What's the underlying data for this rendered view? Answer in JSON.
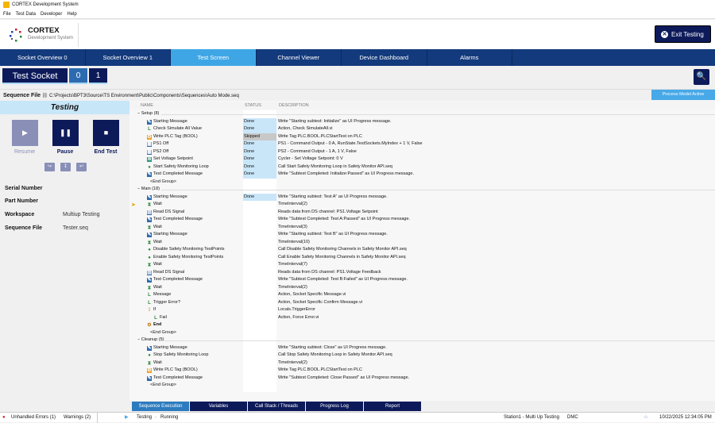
{
  "window": {
    "title": "CORTEX Development System"
  },
  "menu": [
    "File",
    "Test Data",
    "Developer",
    "Help"
  ],
  "logo": {
    "title": "CORTEX",
    "subtitle": "Development System"
  },
  "exit_button": "Exit Testing",
  "nav_tabs": [
    {
      "label": "Socket Overview 0"
    },
    {
      "label": "Socket Overview 1"
    },
    {
      "label": "Test Screen",
      "active": true
    },
    {
      "label": "Channel Viewer"
    },
    {
      "label": "Device Dashboard"
    },
    {
      "label": "Alarms"
    }
  ],
  "socket": {
    "label": "Test Socket",
    "buttons": [
      "0",
      "1"
    ],
    "selected": "0"
  },
  "sequence_file": {
    "label": "Sequence File",
    "path": "C:\\Projects\\BPT3\\Source\\TS Environment\\Public\\Components\\Sequences\\Auto Mode.seq",
    "badge": "Process Model Active"
  },
  "left": {
    "state": "Testing",
    "resume": "Resume",
    "pause": "Pause",
    "end_test": "End Test",
    "info": [
      {
        "key": "Serial Number",
        "value": ""
      },
      {
        "key": "Part Number",
        "value": ""
      },
      {
        "key": "Workspace",
        "value": "Multiup Testing"
      },
      {
        "key": "Sequence File",
        "value": "Tester.seq"
      }
    ]
  },
  "table": {
    "columns": [
      "NAME",
      "STATUS",
      "DESCRIPTION"
    ],
    "rows": [
      {
        "group": "Setup (8)"
      },
      {
        "icon": "message",
        "name": "Starting Message",
        "status": "Done",
        "desc": "Write \"Starting subtest: Initialize\" as UI Progress message."
      },
      {
        "icon": "action",
        "name": "Check Simulate All Value",
        "status": "Done",
        "desc": "Action,  Check SimulateAll.vi"
      },
      {
        "icon": "plc",
        "name": "Write PLC Tag (BOOL)",
        "status": "Skipped",
        "desc": "Write Tag PLC.BOOL.PLCStartTest on PLC"
      },
      {
        "icon": "ps",
        "name": "PS1 Off",
        "status": "Done",
        "desc": "PS1 - Command Output - 0 A, RunState.TestSockets.MyIndex + 1 V, False"
      },
      {
        "icon": "ps",
        "name": "PS2 Off",
        "status": "Done",
        "desc": "PS2 - Command Output - 1 A, 1 V, False"
      },
      {
        "icon": "cycler",
        "name": "Set Voltage Setpoint",
        "status": "Done",
        "desc": "Cycler - Set Voltage Setpoint: 0 V"
      },
      {
        "icon": "safety",
        "name": "Start Safety Monitoring Loop",
        "status": "Done",
        "desc": "Call Start Safety Monitoring Loop in Safety Monitor API.seq"
      },
      {
        "icon": "message",
        "name": "Test Completed Message",
        "status": "Done",
        "desc": "Write \"Subtest Completed: Initialize:Passed\" as UI Progress message."
      },
      {
        "end": "<End Group>"
      },
      {
        "group": "Main (18)"
      },
      {
        "icon": "message",
        "name": "Starting Message",
        "status": "Done",
        "desc": "Write \"Starting subtest: Test A\" as UI Progress message."
      },
      {
        "icon": "wait",
        "name": "Wait",
        "desc": "TimeInterval(2)",
        "current": true
      },
      {
        "icon": "read",
        "name": "Read DS Signal",
        "desc": "Reads data from DS channel: PS1.Voltage Setpoint"
      },
      {
        "icon": "message",
        "name": "Test Completed Message",
        "desc": "Write \"Subtest Completed: Test A:Passed\" as UI Progress message."
      },
      {
        "icon": "wait",
        "name": "Wait",
        "desc": "TimeInterval(3)"
      },
      {
        "icon": "message",
        "name": "Starting Message",
        "desc": "Write \"Starting subtest: Test B\" as UI Progress message."
      },
      {
        "icon": "wait",
        "name": "Wait",
        "desc": "TimeInterval(10)"
      },
      {
        "icon": "safety",
        "name": "Disable Safety Monitoring TestPoints",
        "desc": "Call Disable Safety Monitoring Channels in Safety Monitor API.seq"
      },
      {
        "icon": "safety",
        "name": "Enable Safety Monitoring TestPoints",
        "desc": "Call Enable Safety Monitoring Channels in Safety Monitor API.seq"
      },
      {
        "icon": "wait",
        "name": "Wait",
        "desc": "TimeInterval(7)"
      },
      {
        "icon": "read",
        "name": "Read DS Signal",
        "desc": "Reads data from DS channel: PS1.Voltage Feedback"
      },
      {
        "icon": "message",
        "name": "Test Completed Message",
        "desc": "Write \"Subtest Completed: Test B:Failed\" as UI Progress message."
      },
      {
        "icon": "wait",
        "name": "Wait",
        "desc": "TimeInterval(2)"
      },
      {
        "icon": "action",
        "name": "Message",
        "desc": "Action,  Socket Specific Message.vi"
      },
      {
        "icon": "action",
        "name": "Trigger Error?",
        "desc": "Action,  Socket Specific Confirm Message.vi"
      },
      {
        "icon": "if",
        "name": "If",
        "desc": "Locals.TriggerError"
      },
      {
        "icon": "action",
        "name": "Fail",
        "desc": "Action,  Force Error.vi",
        "indent": true
      },
      {
        "icon": "end",
        "name": "End",
        "desc": "",
        "bold": true
      },
      {
        "end": "<End Group>"
      },
      {
        "group": "Cleanup (5)"
      },
      {
        "icon": "message",
        "name": "Starting Message",
        "desc": "Write \"Starting subtest: Close\" as UI Progress message."
      },
      {
        "icon": "safety",
        "name": "Stop Safety Monitoring Loop",
        "desc": "Call Stop Safety Monitoring Loop in Safety Monitor API.seq"
      },
      {
        "icon": "wait",
        "name": "Wait",
        "desc": "TimeInterval(2)"
      },
      {
        "icon": "plc",
        "name": "Write PLC Tag (BOOL)",
        "desc": "Write Tag PLC.BOOL.PLCStartTest on PLC"
      },
      {
        "icon": "message",
        "name": "Test Completed Message",
        "desc": "Write \"Subtest Completed: Close:Passed\" as UI Progress message."
      },
      {
        "end": "<End Group>"
      }
    ]
  },
  "bottom_tabs": [
    {
      "label": "Sequence Execution",
      "active": true
    },
    {
      "label": "Variables"
    },
    {
      "label": "Call Stack / Threads"
    },
    {
      "label": "Progress Log"
    },
    {
      "label": "Report"
    }
  ],
  "statusbar": {
    "errors": "Unhandled Errors (1)",
    "warnings": "Warnings (2)",
    "state": "Testing",
    "running": "Running",
    "station": "Station1 - Multi Up Testing",
    "user": "DMC",
    "datetime": "10/22/2025 12:34:05 PM"
  },
  "colors": {
    "navy": "#0d1a5a",
    "nav": "#133a7c",
    "active_tab": "#3fa6e6",
    "done": "#c9e6f9",
    "skipped": "#c8c8c8"
  }
}
